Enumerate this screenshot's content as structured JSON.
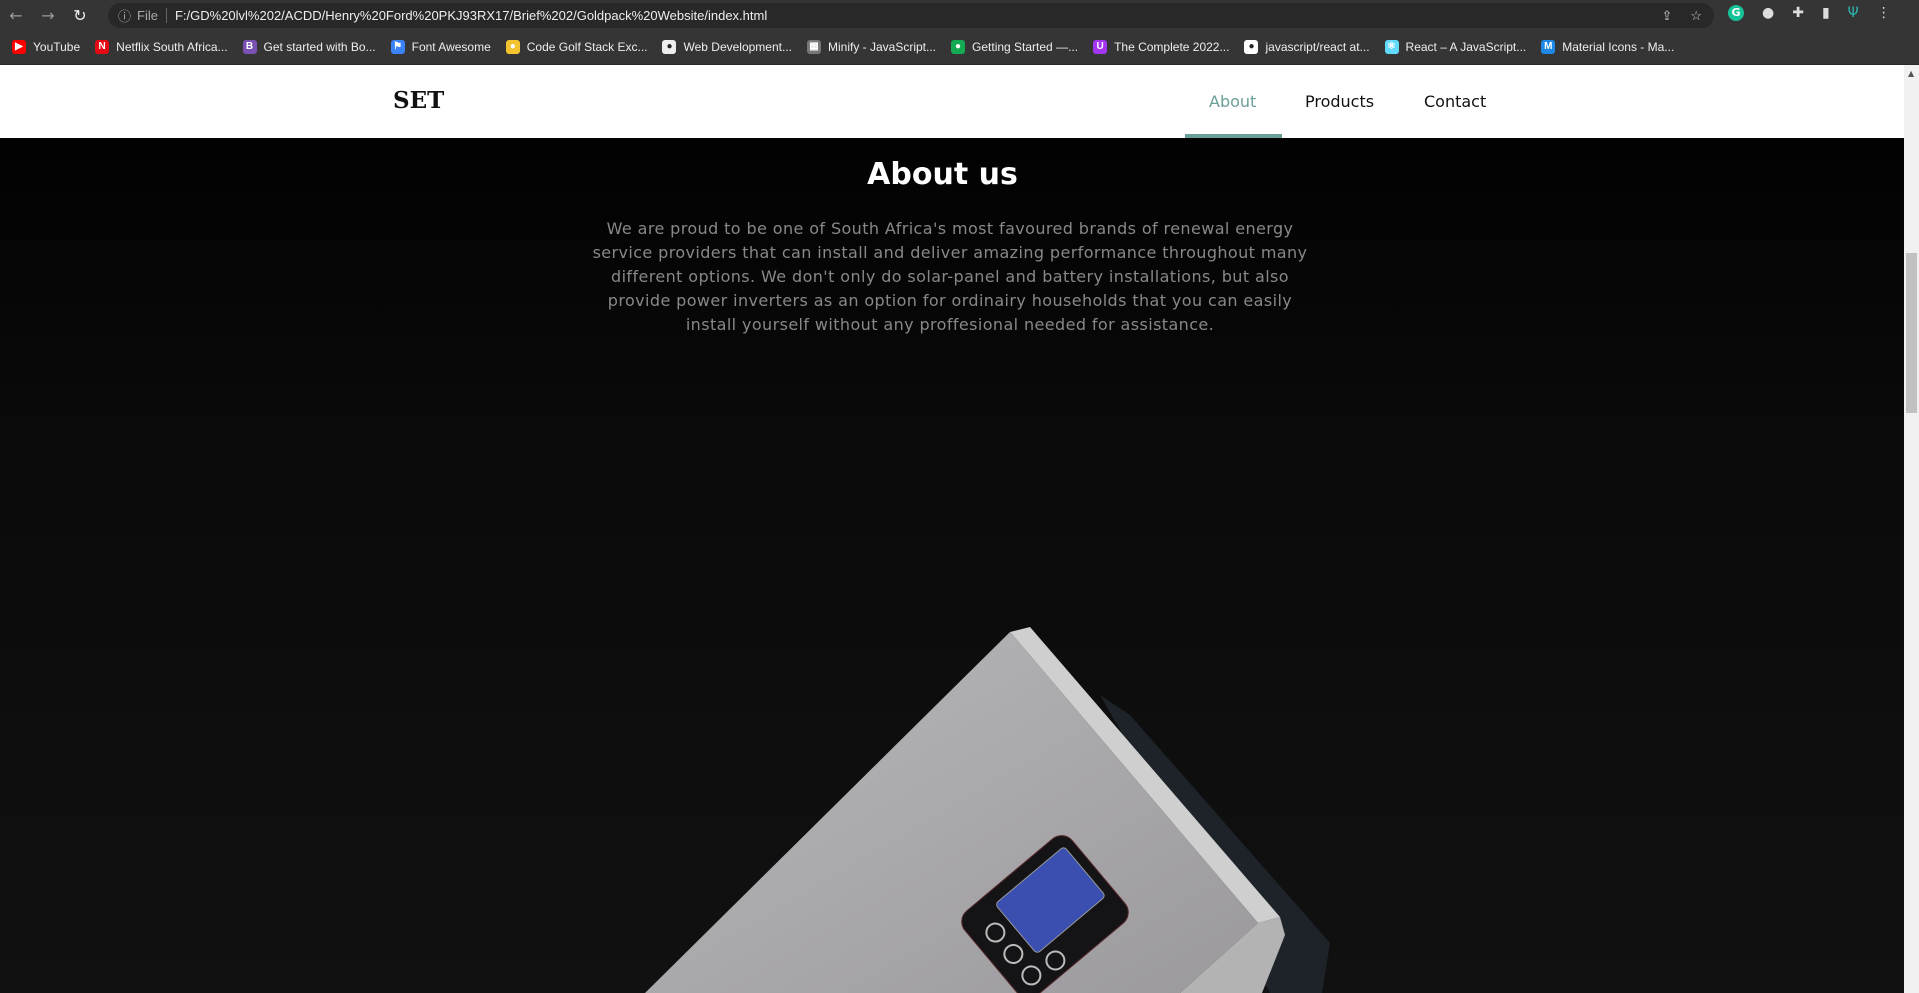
{
  "browser": {
    "scheme_label": "File",
    "url": "F:/GD%20lvl%202/ACDD/Henry%20Ford%20PKJ93RX17/Brief%202/Goldpack%20Website/index.html",
    "bookmarks": [
      {
        "label": "YouTube",
        "color": "#ff0000",
        "glyph": "▶"
      },
      {
        "label": "Netflix South Africa...",
        "color": "#e50914",
        "glyph": "N"
      },
      {
        "label": "Get started with Bo...",
        "color": "#7952b3",
        "glyph": "B"
      },
      {
        "label": "Font Awesome",
        "color": "#3b82f6",
        "glyph": "⚑"
      },
      {
        "label": "Code Golf Stack Exc...",
        "color": "#f4c430",
        "glyph": "●"
      },
      {
        "label": "Web Development...",
        "color": "#eeeeee",
        "glyph": "●"
      },
      {
        "label": "Minify - JavaScript...",
        "color": "#777777",
        "glyph": "▦"
      },
      {
        "label": "Getting Started —...",
        "color": "#13aa52",
        "glyph": "●"
      },
      {
        "label": "The Complete 2022...",
        "color": "#a435f0",
        "glyph": "U"
      },
      {
        "label": "javascript/react at...",
        "color": "#ffffff",
        "glyph": "●"
      },
      {
        "label": "React – A JavaScript...",
        "color": "#61dafb",
        "glyph": "⚛"
      },
      {
        "label": "Material Icons - Ma...",
        "color": "#1e88e5",
        "glyph": "M"
      }
    ]
  },
  "site": {
    "logo": "SET",
    "nav": [
      {
        "label": "About",
        "active": true
      },
      {
        "label": "Products"
      },
      {
        "label": "Contact"
      }
    ],
    "accent": "#6a9e98",
    "heading": "About us",
    "paragraph": "We are proud to be one of South Africa's most favoured brands of renewal energy service providers that can install and deliver amazing performance throughout many different options. We don't only do solar-panel and battery installations, but also provide power inverters as an option for ordinairy households that you can easily install yourself without any proffesional needed for assistance."
  }
}
